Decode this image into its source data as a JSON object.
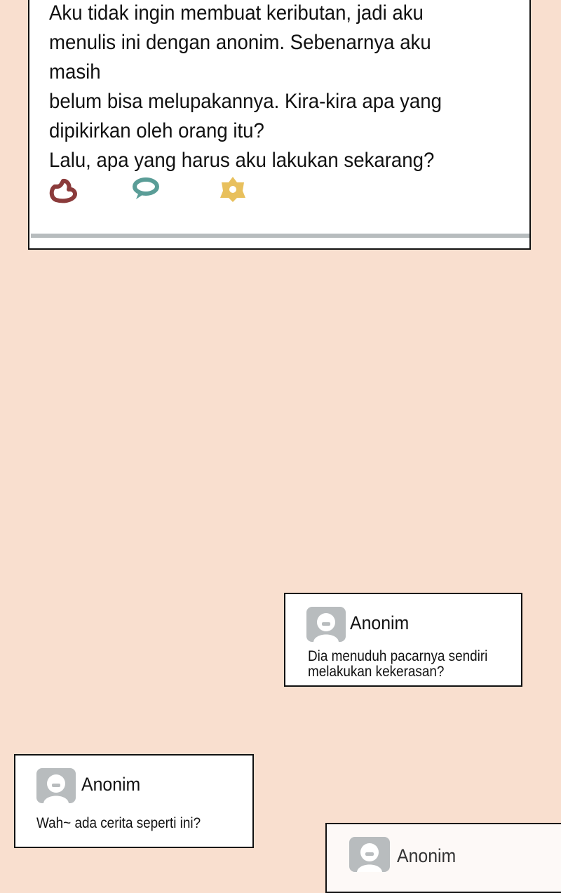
{
  "post": {
    "body": "Aku tidak ingin membuat keributan, jadi aku\nmenulis ini dengan anonim. Sebenarnya aku masih\nbelum bisa melupakannya. Kira-kira apa yang\ndipikirkan oleh orang itu?\nLalu, apa yang harus aku lakukan sekarang?",
    "reactions": [
      {
        "icon": "thumbs-up-icon",
        "color": "#8b3b3b"
      },
      {
        "icon": "speech-bubble-icon",
        "color": "#5a9d97"
      },
      {
        "icon": "flower-icon",
        "color": "#e8c05d"
      }
    ]
  },
  "comments": [
    {
      "author": "Anonim",
      "text": "Dia menuduh pacarnya sendiri\nmelakukan kekerasan?"
    },
    {
      "author": "Anonim",
      "text": "Wah~ ada cerita seperti ini?"
    },
    {
      "author": "Anonim",
      "text": ""
    }
  ]
}
